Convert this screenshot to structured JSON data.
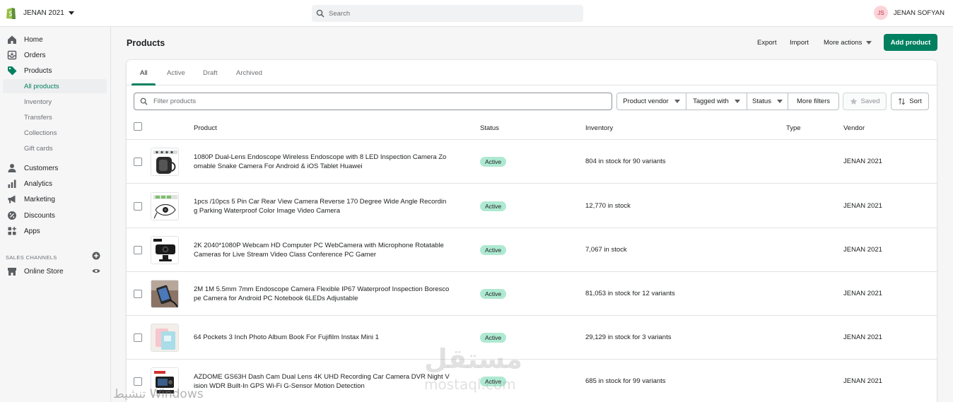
{
  "topbar": {
    "store_name": "JENAN 2021",
    "search_placeholder": "Search",
    "user_initials": "JS",
    "user_name": "JENAN SOFYAN"
  },
  "sidebar": {
    "items": [
      {
        "label": "Home",
        "icon": "home-icon"
      },
      {
        "label": "Orders",
        "icon": "orders-icon"
      },
      {
        "label": "Products",
        "icon": "tag-icon"
      },
      {
        "label": "Customers",
        "icon": "person-icon"
      },
      {
        "label": "Analytics",
        "icon": "bar-chart-icon"
      },
      {
        "label": "Marketing",
        "icon": "megaphone-icon"
      },
      {
        "label": "Discounts",
        "icon": "discount-icon"
      },
      {
        "label": "Apps",
        "icon": "apps-icon"
      }
    ],
    "product_subitems": [
      "All products",
      "Inventory",
      "Transfers",
      "Collections",
      "Gift cards"
    ],
    "sales_channels_heading": "SALES CHANNELS",
    "online_store": "Online Store"
  },
  "header": {
    "title": "Products",
    "export": "Export",
    "import": "Import",
    "more_actions": "More actions",
    "add_product": "Add product"
  },
  "tabs": [
    "All",
    "Active",
    "Draft",
    "Archived"
  ],
  "filters": {
    "placeholder": "Filter products",
    "product_vendor": "Product vendor",
    "tagged_with": "Tagged with",
    "status": "Status",
    "more_filters": "More filters",
    "saved": "Saved",
    "sort": "Sort"
  },
  "table": {
    "headers": [
      "Product",
      "Status",
      "Inventory",
      "Type",
      "Vendor"
    ],
    "rows": [
      {
        "name": "1080P Dual-Lens Endoscope Wireless Endoscope with 8 LED Inspection Camera Zoomable Snake Camera For Android & iOS Tablet Huawei",
        "status": "Active",
        "inventory": "804 in stock for 90 variants",
        "type": "",
        "vendor": "JENAN 2021"
      },
      {
        "name": "1pcs /10pcs 5 Pin Car Rear View Camera Reverse 170 Degree Wide Angle Recording Parking Waterproof Color Image Video Camera",
        "status": "Active",
        "inventory": "12,770 in stock",
        "type": "",
        "vendor": "JENAN 2021"
      },
      {
        "name": "2K 2040*1080P Webcam HD Computer PC WebCamera with Microphone Rotatable Cameras for Live Stream Video Class Conference PC Gamer",
        "status": "Active",
        "inventory": "7,067 in stock",
        "type": "",
        "vendor": "JENAN 2021"
      },
      {
        "name": "2M 1M 5.5mm 7mm Endoscope Camera Flexible IP67 Waterproof Inspection Borescope Camera for Android PC Notebook 6LEDs Adjustable",
        "status": "Active",
        "inventory": "81,053 in stock for 12 variants",
        "type": "",
        "vendor": "JENAN 2021"
      },
      {
        "name": "64 Pockets 3 Inch Photo Album Book For Fujifilm Instax Mini 1",
        "status": "Active",
        "inventory": "29,129 in stock for 3 variants",
        "type": "",
        "vendor": "JENAN 2021"
      },
      {
        "name": "AZDOME GS63H Dash Cam Dual Lens 4K UHD Recording Car Camera DVR Night Vision WDR Built-In GPS Wi-Fi G-Sensor Motion Detection",
        "status": "Active",
        "inventory": "685 in stock for 99 variants",
        "type": "",
        "vendor": "JENAN 2021"
      }
    ]
  },
  "overlay": {
    "watermark": "مستقل",
    "watermark_sub": "mostaql.com",
    "activate_windows": "تنشيط Windows"
  },
  "colors": {
    "brand_green": "#008060",
    "active_badge": "#aee9d1",
    "avatar_bg": "#fbd4d8"
  }
}
